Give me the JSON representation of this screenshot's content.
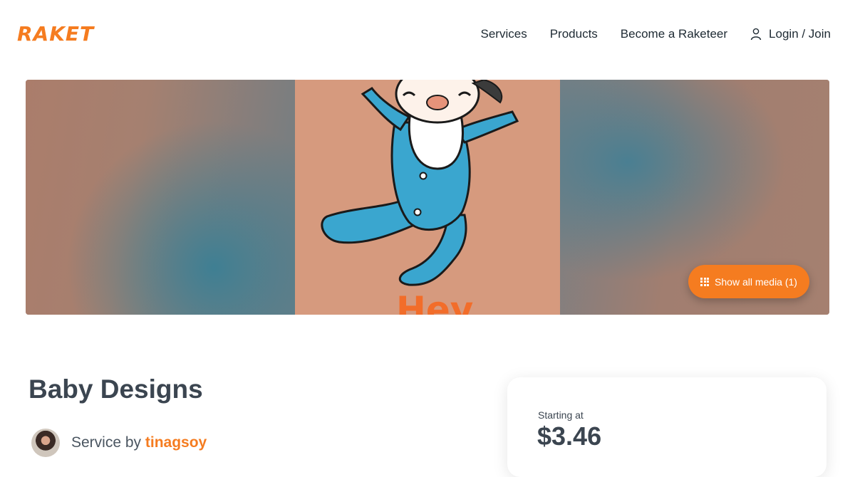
{
  "brand": {
    "logo_text": "RAKET",
    "accent_color": "#f57c20"
  },
  "nav": {
    "items": [
      {
        "label": "Services"
      },
      {
        "label": "Products"
      },
      {
        "label": "Become a Raketeer"
      }
    ],
    "login_label": "Login / Join",
    "login_icon": "user-icon"
  },
  "hero": {
    "illustration_text": "Hey",
    "show_media_label": "Show all media (1)",
    "show_media_icon": "grid-icon"
  },
  "service": {
    "title": "Baby Designs",
    "provider_prefix": "Service by",
    "provider_name": "tinagsoy"
  },
  "pricing": {
    "starting_label": "Starting at",
    "price": "$3.46"
  }
}
